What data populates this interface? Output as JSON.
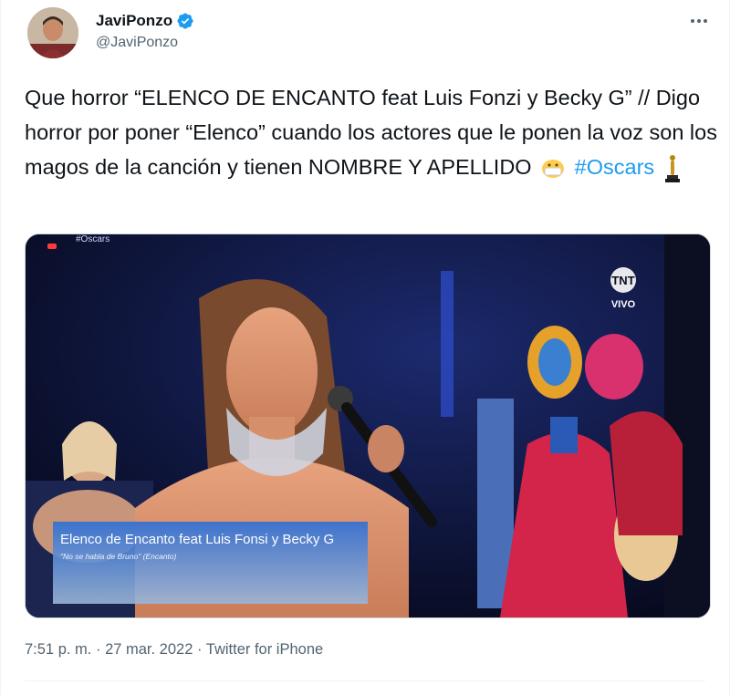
{
  "tweet": {
    "display_name": "JaviPonzo",
    "handle": "@JaviPonzo",
    "text_part1": "Que horror “ELENCO DE ENCANTO feat Luis Fonzi y Becky G” // Digo horror por poner “Elenco” cuando los actores que le ponen la voz son los magos de la canción y tienen NOMBRE Y APELLIDO",
    "hashtag": "#Oscars",
    "time": "7:51 p. m.",
    "date": "27 mar. 2022",
    "separator": "·",
    "source": "Twitter for iPhone"
  },
  "media": {
    "network_logo": "TNT",
    "live_label": "VIVO",
    "top_corner_text": "#Oscars",
    "lower_third_title": "Elenco de Encanto feat Luis Fonsi y Becky G",
    "lower_third_subtitle": "\"No se habla de Bruno\" (Encanto)"
  },
  "icons": {
    "verified": "verified-badge-icon",
    "more": "more-options-icon",
    "emoji": "face-with-symbols-emoji",
    "oscar": "oscar-statuette-emoji"
  },
  "colors": {
    "link": "#1d9bf0",
    "secondary_text": "#536471",
    "verified": "#1d9bf0"
  }
}
